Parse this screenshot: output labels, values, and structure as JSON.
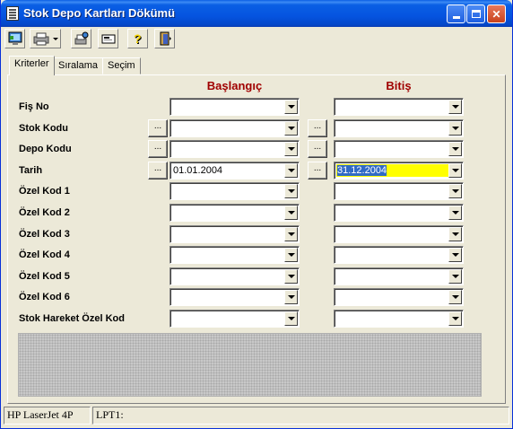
{
  "window": {
    "title": "Stok Depo Kartları Dökümü",
    "controls": {
      "minimize": "minimize",
      "maximize": "maximize",
      "close": "close"
    }
  },
  "toolbar": {
    "buttons": [
      {
        "icon": "screen-preview-icon"
      },
      {
        "icon": "printer-icon"
      },
      {
        "icon": "printer-setup-icon"
      },
      {
        "icon": "export-icon"
      },
      {
        "icon": "help-icon"
      },
      {
        "icon": "exit-door-icon"
      }
    ]
  },
  "tabs": [
    {
      "label": "Kriterler",
      "active": true
    },
    {
      "label": "Sıralama",
      "active": false
    },
    {
      "label": "Seçim",
      "active": false
    }
  ],
  "columns": {
    "start": "Başlangıç",
    "end": "Bitiş"
  },
  "fields": [
    {
      "label": "Fiş No",
      "has_picker": false,
      "start": "",
      "end": ""
    },
    {
      "label": "Stok Kodu",
      "has_picker": true,
      "start": "",
      "end": ""
    },
    {
      "label": "Depo Kodu",
      "has_picker": true,
      "start": "",
      "end": ""
    },
    {
      "label": "Tarih",
      "has_picker": true,
      "start": "01.01.2004",
      "end": "31.12.2004"
    },
    {
      "label": "Özel Kod 1",
      "has_picker": false,
      "start": "",
      "end": ""
    },
    {
      "label": "Özel Kod 2",
      "has_picker": false,
      "start": "",
      "end": ""
    },
    {
      "label": "Özel Kod 3",
      "has_picker": false,
      "start": "",
      "end": ""
    },
    {
      "label": "Özel Kod 4",
      "has_picker": false,
      "start": "",
      "end": ""
    },
    {
      "label": "Özel Kod 5",
      "has_picker": false,
      "start": "",
      "end": ""
    },
    {
      "label": "Özel Kod 6",
      "has_picker": false,
      "start": "",
      "end": ""
    },
    {
      "label": "Stok Hareket Özel Kod",
      "has_picker": false,
      "start": "",
      "end": ""
    }
  ],
  "picker_label": "...",
  "status": {
    "printer": "HP LaserJet 4P",
    "port": "LPT1:"
  },
  "colors": {
    "title_bar": "#0554e0",
    "column_heading": "#a00000",
    "highlight": "#ffff00",
    "selection": "#316ac5"
  }
}
